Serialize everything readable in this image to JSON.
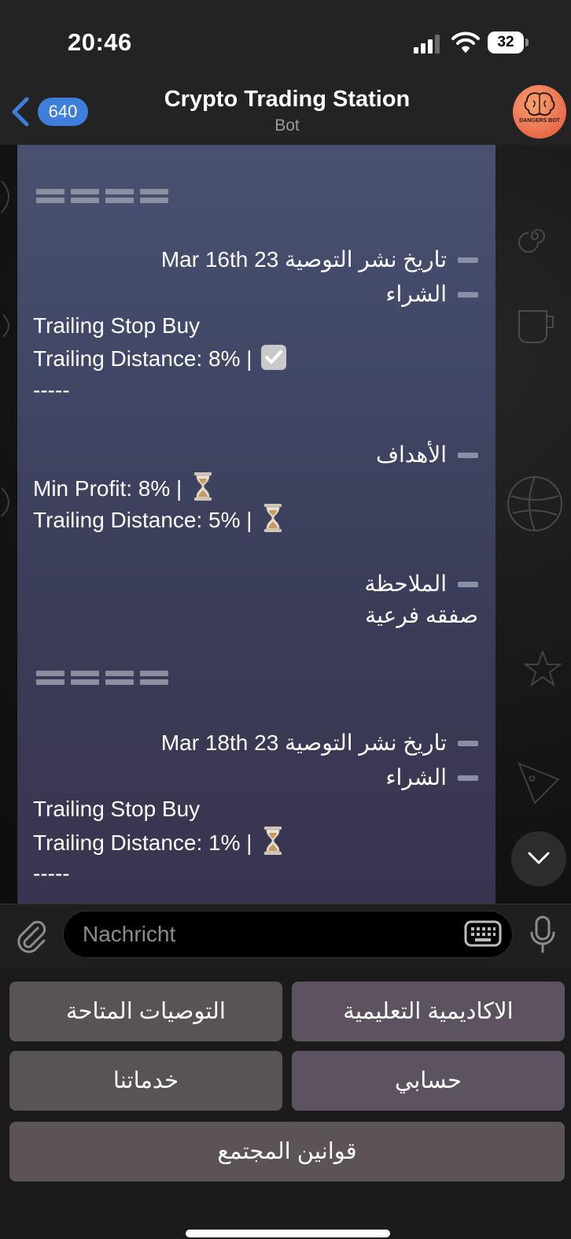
{
  "status_bar": {
    "time": "20:46",
    "battery": "32"
  },
  "header": {
    "back_count": "640",
    "title": "Crypto Trading Station",
    "subtitle": "Bot",
    "avatar_text": "DANGERS BOT"
  },
  "message": {
    "rec1": {
      "date": "تاريخ نشر التوصية Mar 16th 23",
      "buy": "الشراء",
      "order_type": "Trailing Stop Buy",
      "buy_distance": "Trailing Distance: 8% |",
      "divider": "-----",
      "targets": "الأهداف",
      "min_profit": "Min Profit: 8% |",
      "target_distance": "Trailing Distance: 5% |",
      "note_label": "الملاحظة",
      "note": "صفقه فرعية"
    },
    "rec2": {
      "date": "تاريخ نشر التوصية Mar 18th 23",
      "buy": "الشراء",
      "order_type": "Trailing Stop Buy",
      "buy_distance": "Trailing Distance: 1% |",
      "divider": "-----"
    }
  },
  "input": {
    "placeholder": "Nachricht"
  },
  "keyboard": {
    "available_recommendations": "التوصيات المتاحة",
    "academy": "الاكاديمية التعليمية",
    "our_services": "خدماتنا",
    "my_account": "حسابي",
    "community_rules": "قوانين المجتمع"
  },
  "icons": {
    "status_emoji_done": "check-box-icon",
    "status_emoji_pending": "hourglass-icon"
  },
  "colors": {
    "accent": "#3e7fdc",
    "bubble": "#3f4563"
  }
}
